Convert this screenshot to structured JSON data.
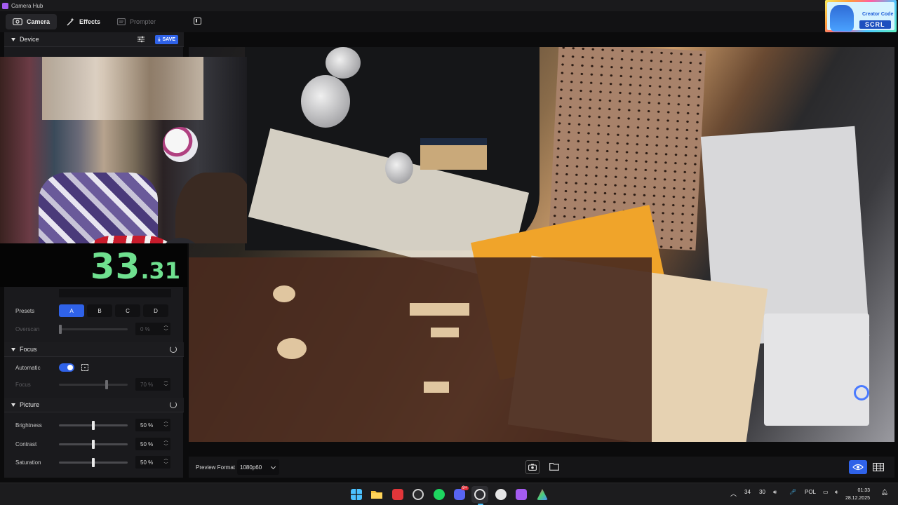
{
  "window": {
    "title": "Camera Hub"
  },
  "tabs": [
    {
      "label": "Camera",
      "icon": "camera-icon",
      "state": "active"
    },
    {
      "label": "Effects",
      "icon": "effects-wand-icon",
      "state": "normal"
    },
    {
      "label": "Prompter",
      "icon": "prompter-icon",
      "state": "disabled"
    }
  ],
  "creator_code": {
    "title": "Creator Code",
    "code": "SCRL"
  },
  "device": {
    "header": "Device",
    "save_label": "SAVE"
  },
  "timer_overlay": {
    "whole": "33",
    "fraction": ".31",
    "color": "#6fe08f"
  },
  "presets": {
    "label": "Presets",
    "options": [
      "A",
      "B",
      "C",
      "D"
    ],
    "selected": "A",
    "overscan_label": "Overscan",
    "overscan_value": "0 %",
    "overscan_level": 0
  },
  "focus": {
    "header": "Focus",
    "automatic_label": "Automatic",
    "automatic_on": true,
    "focus_label": "Focus",
    "focus_value": "70 %",
    "focus_level": 0.7
  },
  "picture": {
    "header": "Picture",
    "brightness_label": "Brightness",
    "brightness_value": "50 %",
    "brightness_level": 0.5,
    "contrast_label": "Contrast",
    "contrast_value": "50 %",
    "contrast_level": 0.5,
    "saturation_label": "Saturation",
    "saturation_value": "50 %",
    "saturation_level": 0.5
  },
  "preview_bar": {
    "format_label": "Preview Format",
    "format_value": "1080p60"
  },
  "taskbar": {
    "apps": [
      "start-icon",
      "file-explorer-icon",
      "vivaldi-icon",
      "obs-icon",
      "spotify-icon",
      "discord-icon",
      "camera-hub-icon",
      "settings-icon",
      "twitch-icon",
      "app-icon"
    ],
    "discord_badge": "9+",
    "tray_temp": "34",
    "tray_fps": "30",
    "language": "POL",
    "time": "01:33",
    "date": "28.12.2025"
  },
  "colors": {
    "accent": "#2f62e8",
    "panel": "#1a1a1d",
    "timer_green": "#6fe08f"
  }
}
